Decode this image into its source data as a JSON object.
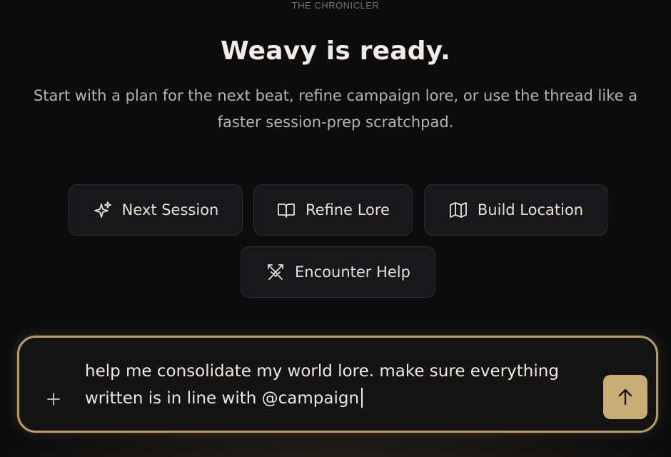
{
  "brand": {
    "label": "THE CHRONICLER"
  },
  "hero": {
    "title": "Weavy is ready.",
    "subtitle": "Start with a plan for the next beat, refine campaign lore, or use the thread like a faster session-prep scratchpad."
  },
  "quick_actions": [
    {
      "label": "Next Session",
      "icon": "sparkle-icon"
    },
    {
      "label": "Refine Lore",
      "icon": "book-icon"
    },
    {
      "label": "Build Location",
      "icon": "map-icon"
    },
    {
      "label": "Encounter Help",
      "icon": "crossed-swords-icon"
    }
  ],
  "composer": {
    "value": "help me consolidate my world lore. make sure everything written is in line with @campaign",
    "attach_icon": "plus-icon",
    "send_icon": "arrow-up-icon"
  },
  "colors": {
    "background": "#0c0c0d",
    "accent": "#c9ad76",
    "composer_border": "#b39a68",
    "chip_bg": "#18181a"
  }
}
